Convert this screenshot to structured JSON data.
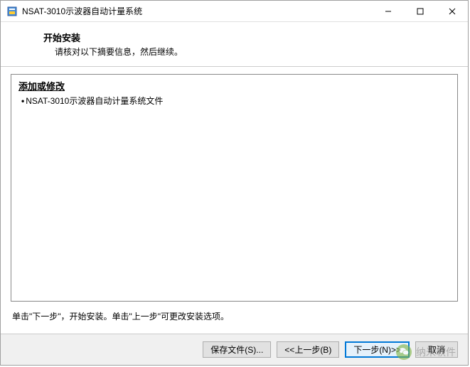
{
  "window": {
    "title": "NSAT-3010示波器自动计量系统"
  },
  "header": {
    "title": "开始安装",
    "subtitle": "请核对以下摘要信息，然后继续。"
  },
  "content": {
    "section_title": "添加或修改",
    "items": [
      "NSAT-3010示波器自动计量系统文件"
    ]
  },
  "instruction": "单击\"下一步\"，开始安装。单击\"上一步\"可更改安装选项。",
  "buttons": {
    "save": "保存文件(S)...",
    "back": "<<上一步(B)",
    "next": "下一步(N)>>",
    "cancel": "取消"
  },
  "watermark": {
    "text": "纳米软件"
  }
}
